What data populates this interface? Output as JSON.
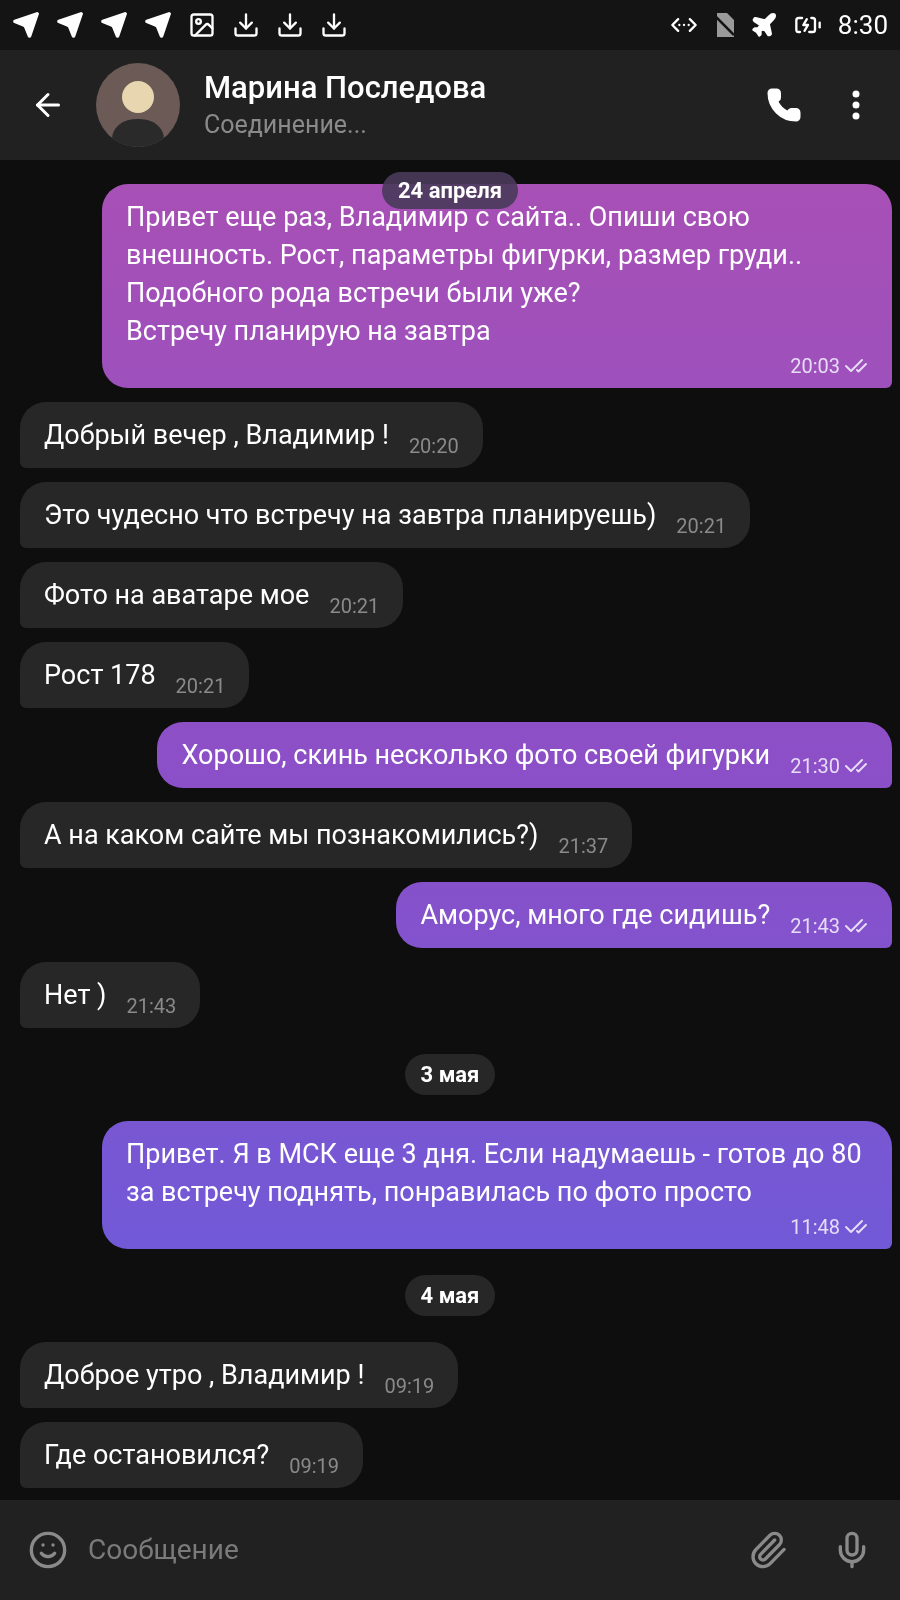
{
  "status_bar": {
    "time": "8:30"
  },
  "header": {
    "name": "Марина Последова",
    "status": "Соединение..."
  },
  "sticky_date": "24 апреля",
  "messages": [
    {
      "kind": "message",
      "out": true,
      "text": "Привет еще раз, Владимир с сайта.. Опиши свою внешность. Рост, параметры фигурки, размер груди..\nПодобного рода встречи были уже?\nВстречу планирую на завтра",
      "time": "20:03",
      "read": true
    },
    {
      "kind": "message",
      "out": false,
      "text": "Добрый вечер , Владимир !",
      "time": "20:20"
    },
    {
      "kind": "message",
      "out": false,
      "text": "Это чудесно что встречу на завтра планируешь)",
      "time": "20:21"
    },
    {
      "kind": "message",
      "out": false,
      "text": "Фото на аватаре мое",
      "time": "20:21"
    },
    {
      "kind": "message",
      "out": false,
      "text": "Рост 178",
      "time": "20:21"
    },
    {
      "kind": "message",
      "out": true,
      "text": "Хорошо, скинь несколько фото своей фигурки",
      "time": "21:30",
      "read": true
    },
    {
      "kind": "message",
      "out": false,
      "text": "А на каком сайте мы познакомились?)",
      "time": "21:37"
    },
    {
      "kind": "message",
      "out": true,
      "text": "Аморус, много где сидишь?",
      "time": "21:43",
      "read": true
    },
    {
      "kind": "message",
      "out": false,
      "text": "Нет )",
      "time": "21:43"
    },
    {
      "kind": "date",
      "text": "3 мая"
    },
    {
      "kind": "message",
      "out": true,
      "text": "Привет. Я в МСК еще 3 дня. Если надумаешь - готов до 80 за встречу поднять, понравилась по фото просто",
      "time": "11:48",
      "read": true
    },
    {
      "kind": "date",
      "text": "4 мая"
    },
    {
      "kind": "message",
      "out": false,
      "text": "Доброе утро , Владимир !",
      "time": "09:19"
    },
    {
      "kind": "message",
      "out": false,
      "text": "Где остановился?",
      "time": "09:19"
    }
  ],
  "composer": {
    "placeholder": "Сообщение"
  }
}
